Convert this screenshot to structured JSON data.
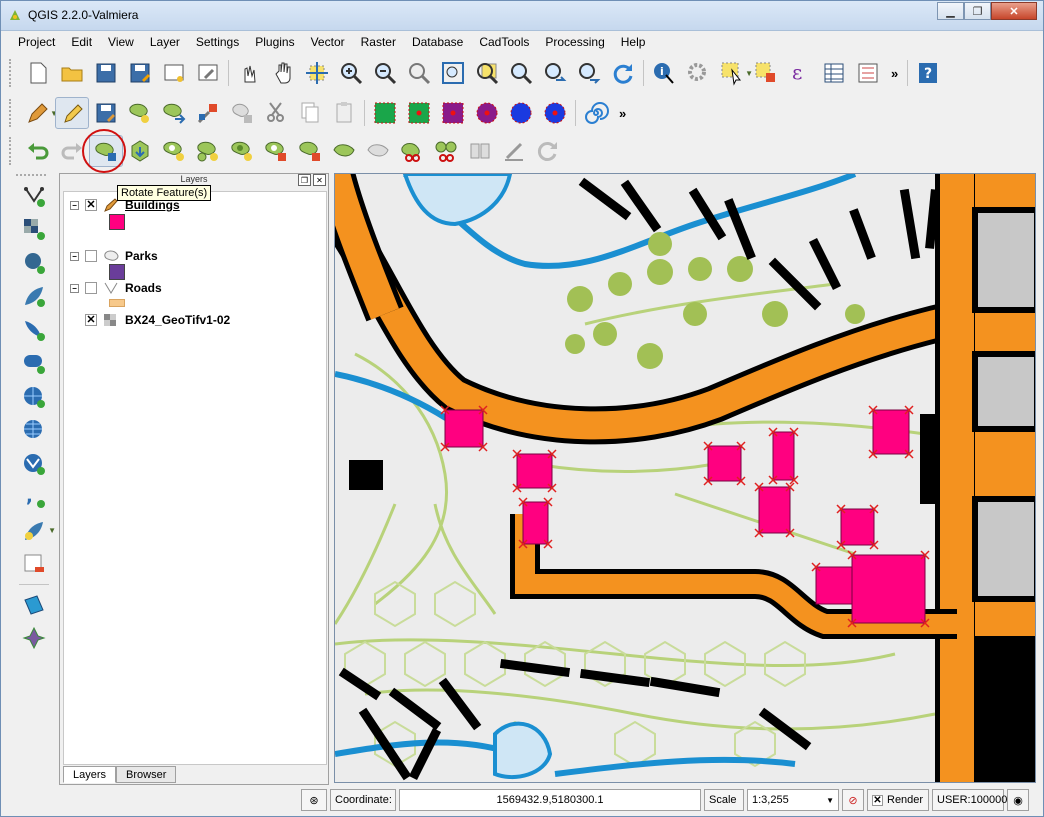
{
  "window": {
    "title": "QGIS 2.2.0-Valmiera"
  },
  "menu": [
    "Project",
    "Edit",
    "View",
    "Layer",
    "Settings",
    "Plugins",
    "Vector",
    "Raster",
    "Database",
    "CadTools",
    "Processing",
    "Help"
  ],
  "tooltip": "Rotate Feature(s)",
  "layers_panel": {
    "title": "Layers",
    "layers": [
      {
        "name": "Buildings",
        "visible": true,
        "swatch": "#ff0080"
      },
      {
        "name": "Parks",
        "visible": false,
        "swatch": "#6a3d9a"
      },
      {
        "name": "Roads",
        "visible": false,
        "swatch": "#f7c98b"
      },
      {
        "name": "BX24_GeoTifv1-02",
        "visible": true
      }
    ],
    "tabs": [
      "Layers",
      "Browser"
    ]
  },
  "status": {
    "coordinate_label": "Coordinate:",
    "coordinate_value": "1569432.9,5180300.1",
    "scale_label": "Scale",
    "scale_value": "1:3,255",
    "render_label": "Render",
    "crs": "USER:100000"
  },
  "colors": {
    "road": "#f4921f",
    "water": "#1a8fd1",
    "building": "#ff0080",
    "green": "#a2c055"
  }
}
